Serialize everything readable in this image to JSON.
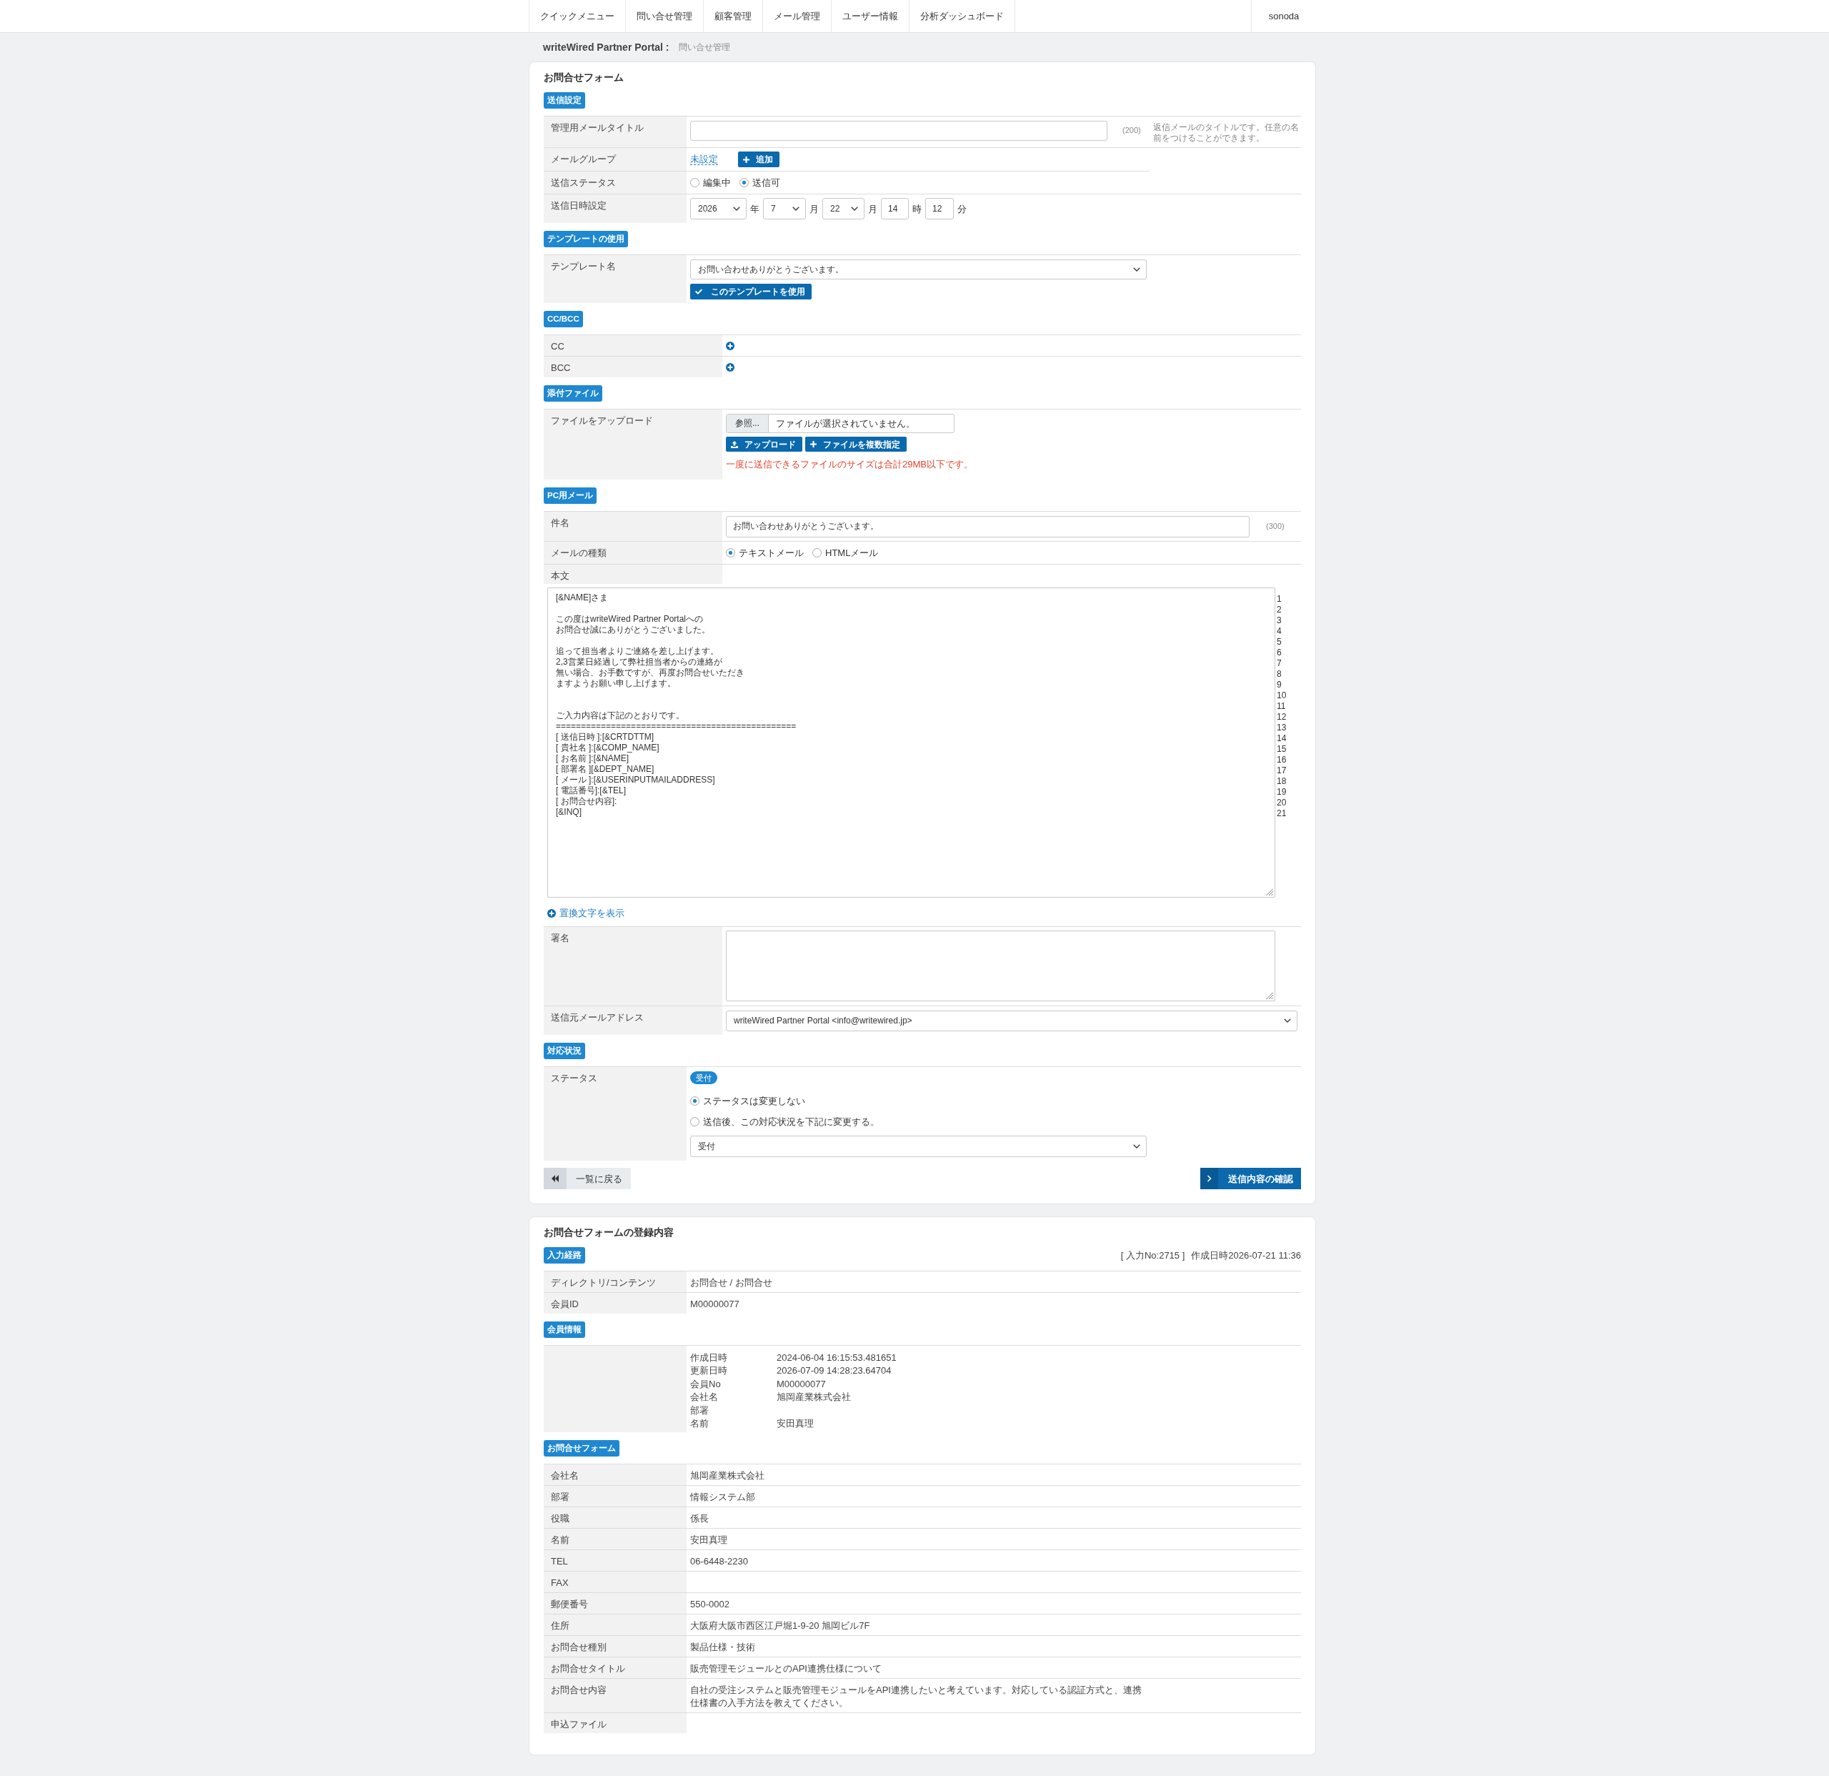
{
  "nav": {
    "items": [
      "クイックメニュー",
      "問い合せ管理",
      "顧客管理",
      "メール管理",
      "ユーザー情報",
      "分析ダッシュボード"
    ],
    "user": "sonoda"
  },
  "breadcrumb": {
    "site": "writeWired Partner Portal :",
    "page": "問い合せ管理"
  },
  "form": {
    "title": "お問合せフォーム",
    "send_settings": {
      "badge": "送信設定",
      "mail_title": {
        "label": "管理用メールタイトル",
        "limit": "(200)",
        "hint": "返信メールのタイトルです。任意の名前をつけることができます。"
      },
      "mail_group": {
        "label": "メールグループ",
        "value": "未設定",
        "button": "追加"
      },
      "send_status": {
        "label": "送信ステータス",
        "options": [
          {
            "label": "編集中",
            "selected": false
          },
          {
            "label": "送信可",
            "selected": true
          }
        ]
      },
      "send_datetime": {
        "label": "送信日時設定",
        "parts": [
          {
            "kind": "select",
            "value": "2026",
            "unit": "年"
          },
          {
            "kind": "select",
            "value": "7",
            "unit": "月"
          },
          {
            "kind": "select",
            "value": "22",
            "unit": "月"
          },
          {
            "kind": "input",
            "value": "14",
            "unit": "時"
          },
          {
            "kind": "input",
            "value": "12",
            "unit": "分"
          }
        ]
      }
    },
    "template": {
      "badge": "テンプレートの使用",
      "label": "テンプレート名",
      "value": "お問い合わせありがとうございます。",
      "button": "このテンプレートを使用"
    },
    "cc_bcc": {
      "badge": "CC/BCC",
      "rows": [
        {
          "label": "CC"
        },
        {
          "label": "BCC"
        }
      ]
    },
    "attachment": {
      "badge": "添付ファイル",
      "label": "ファイルをアップロード",
      "browse": "参照...",
      "file_status": "ファイルが選択されていません。",
      "buttons": [
        {
          "kind": "upload",
          "label": "アップロード"
        },
        {
          "kind": "add",
          "label": "ファイルを複数指定"
        }
      ],
      "note": "一度に送信できるファイルのサイズは合計29MB以下です。"
    },
    "pc_mail": {
      "badge": "PC用メール",
      "subject": {
        "label": "件名",
        "value": "お問い合わせありがとうございます。",
        "limit": "(300)"
      },
      "mail_type": {
        "label": "メールの種類",
        "options": [
          {
            "label": "テキストメール",
            "selected": true
          },
          {
            "label": "HTMLメール",
            "selected": false
          }
        ]
      },
      "body": {
        "label": "本文",
        "lines": [
          {
            "kind": "text",
            "text": "[&NAME]さま"
          },
          {
            "kind": "blank"
          },
          {
            "kind": "text",
            "text": "この度はwriteWired Partner Portalへの"
          },
          {
            "kind": "text",
            "text": "お問合せ誠にありがとうございました。"
          },
          {
            "kind": "blank"
          },
          {
            "kind": "text",
            "text": "追って担当者よりご連絡を差し上げます。"
          },
          {
            "kind": "text",
            "text": "2,3営業日経過して弊社担当者からの連絡が"
          },
          {
            "kind": "text",
            "text": "無い場合、お手数ですが、再度お問合せいただき"
          },
          {
            "kind": "text",
            "text": "ますようお願い申し上げます。"
          },
          {
            "kind": "blank"
          },
          {
            "kind": "blank"
          },
          {
            "kind": "text",
            "text": "ご入力内容は下記のとおりです。"
          },
          {
            "kind": "text",
            "text": "================================================"
          },
          {
            "kind": "text",
            "text": "[ 送信日時 ]:[&CRTDTTM]"
          },
          {
            "kind": "text",
            "text": "[ 貴社名 ]:[&COMP_NAME]"
          },
          {
            "kind": "text",
            "text": "[ お名前 ]:[&NAME]"
          },
          {
            "kind": "text",
            "text": "[ 部署名 ][&DEPT_NAME]"
          },
          {
            "kind": "text",
            "text": "[ メール ]:[&USERINPUTMAILADDRESS]"
          },
          {
            "kind": "text",
            "text": "[ 電話番号]:[&TEL]"
          },
          {
            "kind": "text",
            "text": "[ お問合せ内容]:"
          },
          {
            "kind": "text",
            "text": "[&INQ]"
          }
        ],
        "line_numbers": [
          "1",
          "2",
          "3",
          "4",
          "5",
          "6",
          "7",
          "8",
          "9",
          "10",
          "11",
          "12",
          "13",
          "14",
          "15",
          "16",
          "17",
          "18",
          "19",
          "20",
          "21"
        ]
      },
      "replace_link": "置換文字を表示",
      "signature": {
        "label": "署名"
      },
      "from_address": {
        "label": "送信元メールアドレス",
        "value": "writeWired Partner Portal <info@writewired.jp>"
      }
    },
    "status": {
      "badge": "対応状況",
      "label": "ステータス",
      "current": "受付",
      "options": [
        {
          "label": "ステータスは変更しない",
          "selected": true
        },
        {
          "label": "送信後、この対応状況を下記に変更する。",
          "selected": false
        }
      ],
      "new_status": "受付"
    },
    "back_button": "一覧に戻る",
    "confirm_button": "送信内容の確認"
  },
  "record": {
    "title": "お問合せフォームの登録内容",
    "route": {
      "badge": "入力経路",
      "entry_no": "[ 入力No:2715 ]",
      "created": "作成日時2026-07-21 11:36",
      "rows": [
        {
          "label": "ディレクトリ/コンテンツ",
          "value": "お問合せ / お問合せ"
        },
        {
          "label": "会員ID",
          "value": "M00000077"
        }
      ]
    },
    "member": {
      "badge": "会員情報",
      "fields": [
        {
          "label": "作成日時",
          "value": "2024-06-04 16:15:53.481651"
        },
        {
          "label": "更新日時",
          "value": "2026-07-09 14:28:23.64704"
        },
        {
          "label": "会員No",
          "value": "M00000077"
        },
        {
          "label": "会社名",
          "value": "旭岡産業株式会社"
        },
        {
          "label": "部署"
        },
        {
          "label": "名前",
          "value": "安田真理"
        }
      ]
    },
    "inquiry": {
      "badge": "お問合せフォーム",
      "rows": [
        {
          "label": "会社名",
          "value": "旭岡産業株式会社"
        },
        {
          "label": "部署",
          "value": "情報システム部"
        },
        {
          "label": "役職",
          "value": "係長"
        },
        {
          "label": "名前",
          "value": "安田真理"
        },
        {
          "label": "TEL",
          "value": "06-6448-2230"
        },
        {
          "label": "FAX"
        },
        {
          "label": "郵便番号",
          "value": "550-0002"
        },
        {
          "label": "住所",
          "value": "大阪府大阪市西区江戸堀1-9-20 旭岡ビル7F"
        },
        {
          "label": "お問合せ種別",
          "value": "製品仕様・技術"
        },
        {
          "label": "お問合せタイトル",
          "value": "販売管理モジュールとのAPI連携仕様について"
        },
        {
          "label": "お問合せ内容",
          "value": "自社の受注システムと販売管理モジュールをAPI連携したいと考えています。対応している認証方式と、連携仕様書の入手方法を教えてください。"
        },
        {
          "label": "申込ファイル"
        }
      ]
    }
  }
}
